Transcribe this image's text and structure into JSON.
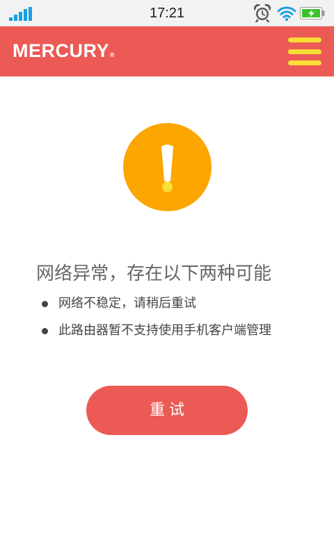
{
  "status_bar": {
    "time": "17:21",
    "signal_icon": "signal-strength-icon",
    "alarm_icon": "alarm-clock-icon",
    "wifi_icon": "wifi-icon",
    "battery_icon": "battery-charging-icon"
  },
  "header": {
    "brand": "MERCURY",
    "brand_mark": "®",
    "menu_icon": "hamburger-menu-icon"
  },
  "error": {
    "icon": "exclamation-icon",
    "title": "网络异常，存在以下两种可能",
    "reasons": [
      "网络不稳定，请稍后重试",
      "此路由器暂不支持使用手机客户端管理"
    ]
  },
  "actions": {
    "retry_label": "重试"
  },
  "colors": {
    "header_bg": "#ec5a55",
    "menu_bars": "#f9de35",
    "warning": "#fda602",
    "retry_bg": "#ec5a55",
    "status_icons": "#1a9ee2",
    "battery_fill": "#3ec12e"
  }
}
